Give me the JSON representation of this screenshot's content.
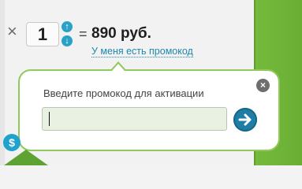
{
  "cart": {
    "times_symbol": "×",
    "quantity": "1",
    "equals_symbol": "=",
    "price": "890 руб.",
    "promo_link": "У меня есть промокод"
  },
  "popup": {
    "label": "Введите промокод для активации",
    "input_value": "",
    "close_symbol": "×"
  },
  "colors": {
    "accent_blue": "#1f7ea5",
    "popup_border": "#90ca5b",
    "side_green": "#6aaf34"
  },
  "icons": [
    "arrow-up-icon",
    "arrow-down-icon",
    "close-icon",
    "arrow-right-icon",
    "dollar-coin-icon"
  ]
}
